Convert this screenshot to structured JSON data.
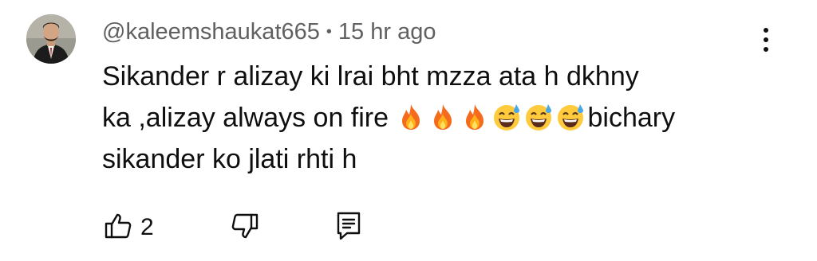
{
  "comment": {
    "author": "@kaleemshaukat665",
    "separator": "•",
    "timestamp": "15 hr ago",
    "text_line_1": "Sikander r alizay ki lrai bht mzza ata h dkhny",
    "text_line_2_start": "ka ,alizay always on fire ",
    "text_line_2_end": "bichary",
    "text_line_3": "sikander ko jlati rhti h",
    "emojis": [
      "fire-emoji",
      "fire-emoji",
      "fire-emoji",
      "grinning-sweat-emoji",
      "grinning-sweat-emoji",
      "grinning-sweat-emoji"
    ],
    "likes": "2"
  },
  "icons": {
    "more": "more-vertical-icon",
    "like": "thumbs-up-icon",
    "dislike": "thumbs-down-icon",
    "reply": "reply-comment-icon"
  },
  "colors": {
    "text": "#0f0f0f",
    "meta": "#606060"
  }
}
